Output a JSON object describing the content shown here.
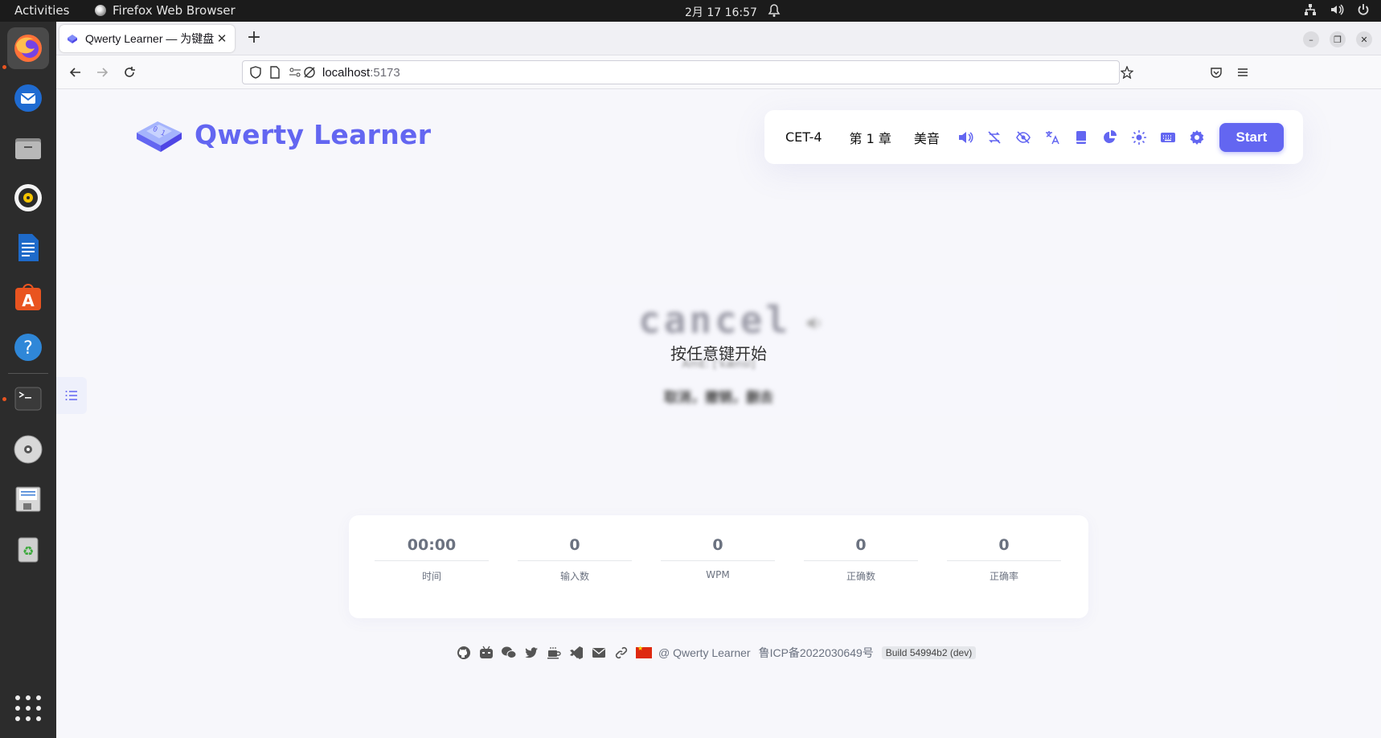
{
  "system": {
    "activities": "Activities",
    "app_name": "Firefox Web Browser",
    "clock": "2月 17  16:57"
  },
  "browser": {
    "tab_title": "Qwerty Learner — 为键盘",
    "url_host": "localhost",
    "url_port": ":5173"
  },
  "app": {
    "logo_text": "Qwerty Learner",
    "toolbar": {
      "dict": "CET-4",
      "chapter": "第 1 章",
      "pronunciation": "美音",
      "start_label": "Start",
      "icons": [
        "volume-icon",
        "loop-off-icon",
        "eye-off-icon",
        "translate-icon",
        "book-icon",
        "pie-chart-icon",
        "sun-icon",
        "keyboard-icon",
        "gear-icon"
      ]
    },
    "word": "cancel",
    "prompt": "按任意键开始",
    "phonetic": "AmE: [ˈkænsl]",
    "translation": "取消，撤销，删去",
    "stats": [
      {
        "value": "00:00",
        "label": "时间"
      },
      {
        "value": "0",
        "label": "输入数"
      },
      {
        "value": "0",
        "label": "WPM"
      },
      {
        "value": "0",
        "label": "正确数"
      },
      {
        "value": "0",
        "label": "正确率"
      }
    ],
    "footer": {
      "credit": "@ Qwerty Learner",
      "icp": "鲁ICP备2022030649号",
      "build": "Build 54994b2 (dev)"
    }
  },
  "colors": {
    "accent": "#6366f1",
    "topbar": "#1b1b1b",
    "dock": "#2c2c2c"
  }
}
